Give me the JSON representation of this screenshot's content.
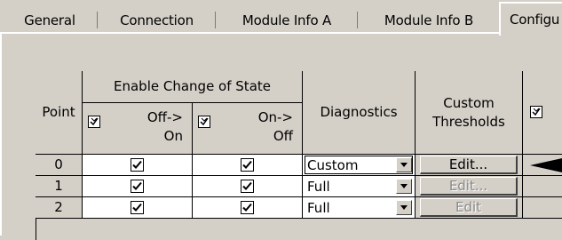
{
  "tabs": [
    {
      "label": "General"
    },
    {
      "label": "Connection"
    },
    {
      "label": "Module Info A"
    },
    {
      "label": "Module Info B"
    },
    {
      "label": "Configu"
    }
  ],
  "table": {
    "headers": {
      "point": "Point",
      "enable_cos": "Enable Change of State",
      "off_on": "Off-> On",
      "on_off": "On-> Off",
      "diagnostics": "Diagnostics",
      "custom_thresholds": "Custom Thresholds"
    },
    "rows": [
      {
        "point": "0",
        "off_on": true,
        "on_off": true,
        "diagnostics": "Custom",
        "edit": "Edit...",
        "edit_enabled": true
      },
      {
        "point": "1",
        "off_on": true,
        "on_off": true,
        "diagnostics": "Full",
        "edit": "Edit...",
        "edit_enabled": false
      },
      {
        "point": "2",
        "off_on": true,
        "on_off": true,
        "diagnostics": "Full",
        "edit": "Edit",
        "edit_enabled": false
      }
    ]
  }
}
